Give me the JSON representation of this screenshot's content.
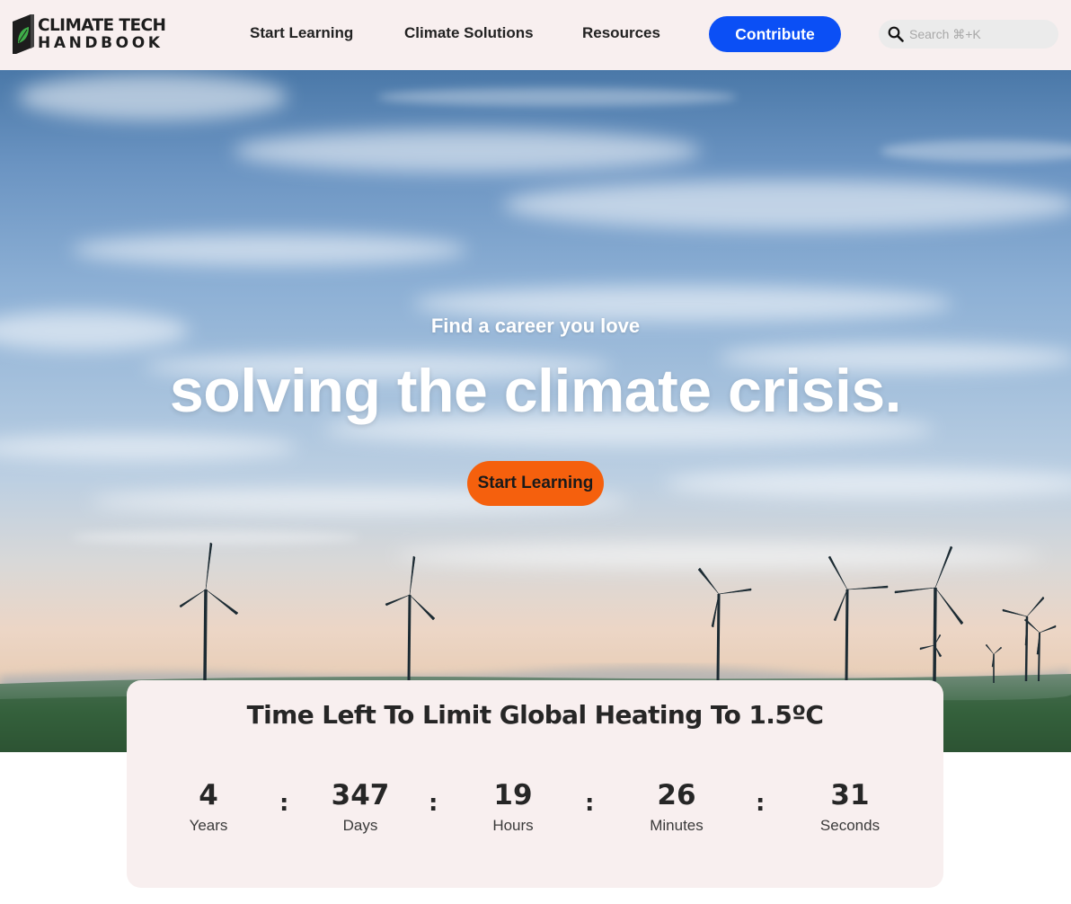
{
  "header": {
    "logo_line1": "CLIMATE TECH",
    "logo_line2": "HANDBOOK",
    "nav": [
      "Start Learning",
      "Climate Solutions",
      "Resources"
    ],
    "contribute_label": "Contribute",
    "search_placeholder": "Search ⌘+K",
    "icons": {
      "logo": "leaf-book-icon",
      "search": "search-icon"
    }
  },
  "hero": {
    "subtitle": "Find a career you love",
    "title": "solving the climate crisis.",
    "cta_label": "Start Learning",
    "cta_color": "#f5600d"
  },
  "countdown": {
    "title": "Time Left To Limit Global Heating To 1.5ºC",
    "units": [
      {
        "value": "4",
        "label": "Years"
      },
      {
        "value": "347",
        "label": "Days"
      },
      {
        "value": "19",
        "label": "Hours"
      },
      {
        "value": "26",
        "label": "Minutes"
      },
      {
        "value": "31",
        "label": "Seconds"
      }
    ],
    "separator": ":"
  },
  "colors": {
    "accent_blue": "#0b4ff5",
    "accent_orange": "#f5600d",
    "header_bg": "#f8efef",
    "logo_green": "#3fae49"
  }
}
